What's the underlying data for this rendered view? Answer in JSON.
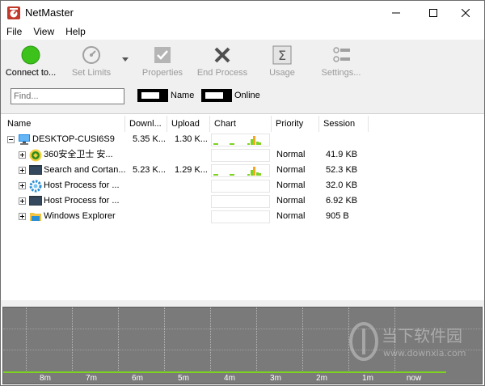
{
  "window": {
    "title": "NetMaster",
    "minimize_icon": "minimize-icon",
    "maximize_icon": "maximize-icon",
    "close_icon": "close-icon"
  },
  "menu": {
    "items": [
      "File",
      "View",
      "Help"
    ]
  },
  "toolbar": {
    "buttons": [
      {
        "label": "Connect to...",
        "icon": "green-circle-icon",
        "enabled": true
      },
      {
        "label": "Set Limits",
        "icon": "gauge-icon",
        "enabled": false
      },
      {
        "label": "Properties",
        "icon": "checkbox-icon",
        "enabled": false
      },
      {
        "label": "End Process",
        "icon": "x-icon",
        "enabled": false
      },
      {
        "label": "Usage",
        "icon": "sigma-icon",
        "enabled": false
      },
      {
        "label": "Settings...",
        "icon": "settings-icon",
        "enabled": false
      }
    ]
  },
  "filter": {
    "find_placeholder": "Find...",
    "find_value": "",
    "toggle_name_label": "Name",
    "toggle_online_label": "Online"
  },
  "table": {
    "columns": [
      "Name",
      "Downl...",
      "Upload",
      "Chart",
      "Priority",
      "Session"
    ],
    "rows": [
      {
        "name": "DESKTOP-CUSI6S9",
        "download": "5.35 K...",
        "upload": "1.30 K...",
        "priority": "",
        "session": "",
        "level": 0,
        "expander": "minus",
        "icon": "computer-icon",
        "chart_levels": [
          0.15,
          0.5,
          0.85,
          0.3,
          0.2
        ],
        "has_chart_data": true
      },
      {
        "name": "360安全卫士 安...",
        "download": "",
        "upload": "",
        "priority": "Normal",
        "session": "41.9 KB",
        "level": 1,
        "expander": "plus",
        "icon": "360-shield-icon",
        "chart_levels": [],
        "has_chart_data": false
      },
      {
        "name": "Search and Cortan...",
        "download": "5.23 K...",
        "upload": "1.29 K...",
        "priority": "Normal",
        "session": "52.3 KB",
        "level": 1,
        "expander": "plus",
        "icon": "app-window-icon",
        "chart_levels": [
          0.15,
          0.5,
          0.85,
          0.3,
          0.2
        ],
        "has_chart_data": true
      },
      {
        "name": "Host Process for ...",
        "download": "",
        "upload": "",
        "priority": "Normal",
        "session": "32.0 KB",
        "level": 1,
        "expander": "plus",
        "icon": "gear-icon",
        "chart_levels": [],
        "has_chart_data": false
      },
      {
        "name": "Host Process for ...",
        "download": "",
        "upload": "",
        "priority": "Normal",
        "session": "6.92 KB",
        "level": 1,
        "expander": "plus",
        "icon": "app-window-icon",
        "chart_levels": [],
        "has_chart_data": false
      },
      {
        "name": "Windows Explorer",
        "download": "",
        "upload": "",
        "priority": "Normal",
        "session": "905 B",
        "level": 1,
        "expander": "plus",
        "icon": "folder-icon",
        "chart_levels": [],
        "has_chart_data": false
      }
    ]
  },
  "graph": {
    "x_ticks": [
      "8m",
      "7m",
      "6m",
      "5m",
      "4m",
      "3m",
      "2m",
      "1m",
      "now"
    ],
    "line_color": "#7ed321",
    "watermark_text": "当下软件园",
    "watermark_url": "www.downxia.com"
  },
  "colors": {
    "green": "#3cc21a",
    "bar_green": "#7ed321",
    "bar_orange": "#f5a623"
  }
}
